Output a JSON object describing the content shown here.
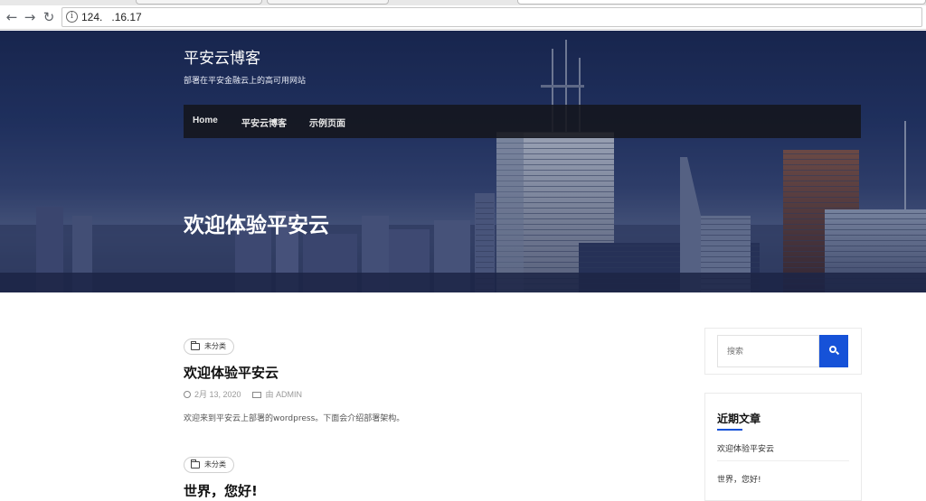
{
  "browser": {
    "url": "124.   .16.17",
    "back_icon": "arrow-left-icon",
    "forward_icon": "arrow-right-icon",
    "reload_icon": "reload-icon",
    "info_icon": "info-icon"
  },
  "site": {
    "title": "平安云博客",
    "description": "部署在平安金融云上的高可用网站"
  },
  "nav": {
    "items": [
      {
        "label": "Home"
      },
      {
        "label": "平安云博客"
      },
      {
        "label": "示例页面"
      }
    ]
  },
  "hero": {
    "title": "欢迎体验平安云"
  },
  "posts": [
    {
      "category": "未分类",
      "title": "欢迎体验平安云",
      "date": "2月 13, 2020",
      "author": "由 ADMIN",
      "excerpt": "欢迎来到平安云上部署的wordpress。下面会介绍部署架构。"
    },
    {
      "category": "未分类",
      "title": "世界，您好!"
    }
  ],
  "sidebar": {
    "search_placeholder": "搜索",
    "recent_title": "近期文章",
    "recent_items": [
      {
        "label": "欢迎体验平安云"
      },
      {
        "label": "世界，您好!"
      }
    ]
  },
  "colors": {
    "accent": "#1652d8",
    "menu_bg": "#16181e"
  }
}
